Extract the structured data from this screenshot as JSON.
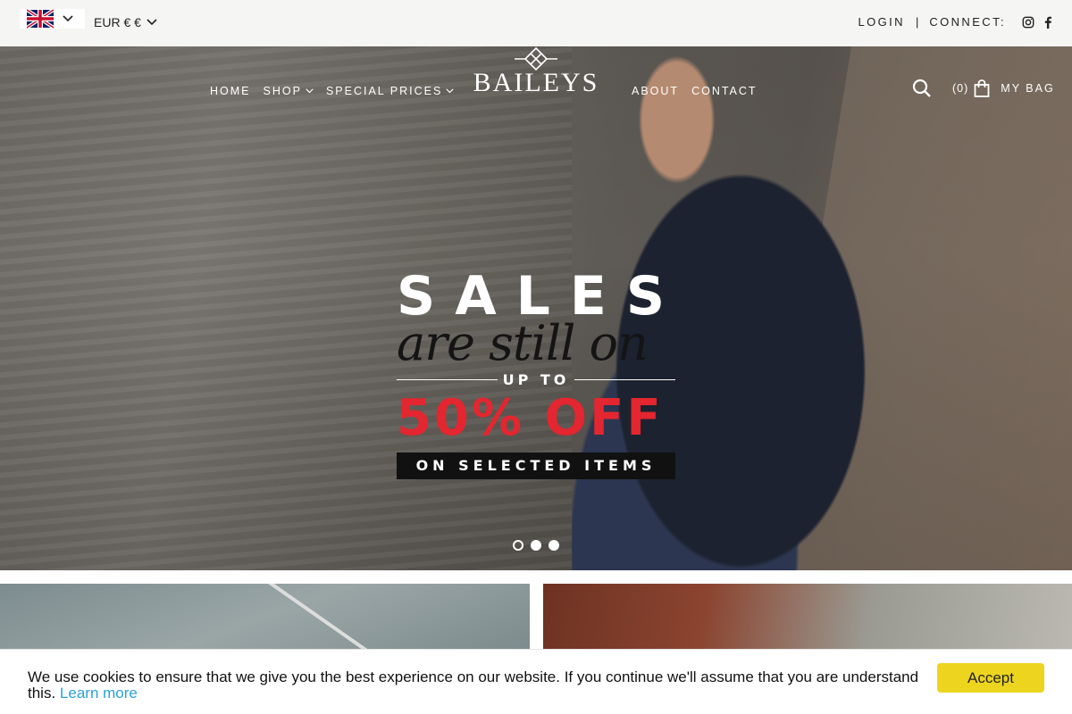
{
  "topbar": {
    "language_flag": "uk-flag-icon",
    "currency": "EUR € €",
    "login": "LOGIN",
    "separator": "|",
    "connect": "CONNECT:",
    "social": [
      "instagram-icon",
      "facebook-icon"
    ]
  },
  "nav": {
    "left": [
      {
        "label": "HOME",
        "dropdown": false
      },
      {
        "label": "SHOP",
        "dropdown": true
      },
      {
        "label": "SPECIAL PRICES",
        "dropdown": true
      }
    ],
    "right": [
      {
        "label": "ABOUT",
        "dropdown": false
      },
      {
        "label": "CONTACT",
        "dropdown": false
      }
    ]
  },
  "logo": {
    "text": "BAILEYS"
  },
  "cart": {
    "count": "(0)",
    "label": "MY BAG"
  },
  "hero": {
    "line1": "SALES",
    "line2": "are still on",
    "line3": "UP TO",
    "line4": "50% OFF",
    "line5": "ON SELECTED ITEMS",
    "slides": 3,
    "active_slide": 1
  },
  "cookie": {
    "message": "We use cookies to ensure that we give you the best experience on our website. If you continue we'll assume that you are understand this.",
    "link": "Learn more",
    "accept": "Accept",
    "link_color": "#2aa2d6",
    "accept_color": "#ecd41f"
  },
  "colors": {
    "sale_red": "#e3262f",
    "topbar_bg": "#f5f5f3"
  }
}
